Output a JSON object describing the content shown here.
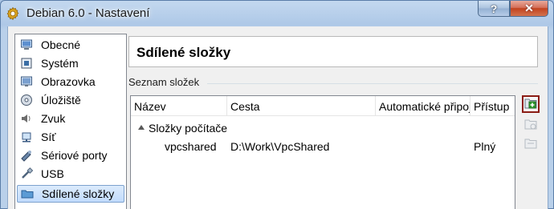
{
  "window": {
    "title": "Debian 6.0 - Nastavení",
    "app_icon": "gear-icon",
    "help_label": "?",
    "close_label": "✕"
  },
  "sidebar": {
    "items": [
      {
        "label": "Obecné",
        "icon": "monitor-icon",
        "selected": false
      },
      {
        "label": "Systém",
        "icon": "chip-icon",
        "selected": false
      },
      {
        "label": "Obrazovka",
        "icon": "display-icon",
        "selected": false
      },
      {
        "label": "Úložiště",
        "icon": "storage-icon",
        "selected": false
      },
      {
        "label": "Zvuk",
        "icon": "speaker-icon",
        "selected": false
      },
      {
        "label": "Síť",
        "icon": "network-icon",
        "selected": false
      },
      {
        "label": "Sériové porty",
        "icon": "serial-port-icon",
        "selected": false
      },
      {
        "label": "USB",
        "icon": "usb-icon",
        "selected": false
      },
      {
        "label": "Sdílené složky",
        "icon": "shared-folder-icon",
        "selected": true
      }
    ]
  },
  "page": {
    "title": "Sdílené složky",
    "group_label": "Seznam složek"
  },
  "table": {
    "columns": [
      "Název",
      "Cesta",
      "Automatické připojení",
      "Přístup"
    ],
    "group_row": "Složky počítače",
    "rows": [
      {
        "name": "vpcshared",
        "path": "D:\\Work\\VpcShared",
        "auto": "",
        "access": "Plný"
      }
    ]
  },
  "toolbar": {
    "buttons": [
      {
        "icon": "add-folder-icon",
        "enabled": true
      },
      {
        "icon": "edit-folder-icon",
        "enabled": false
      },
      {
        "icon": "remove-folder-icon",
        "enabled": false
      }
    ]
  },
  "colors": {
    "selection": "#c1dbfc",
    "selection_border": "#7da2ce",
    "active_tool_border": "#8b1c14",
    "add_icon_green": "#2e9b2e"
  }
}
